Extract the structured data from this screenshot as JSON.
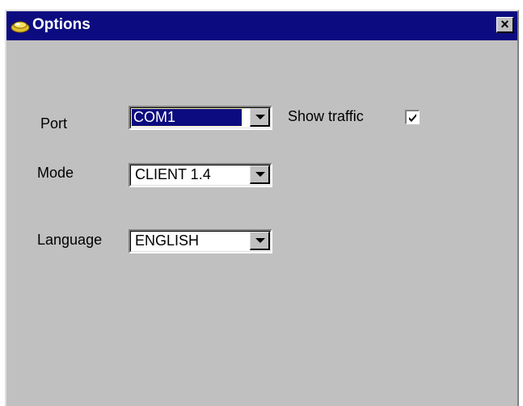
{
  "window": {
    "title": "Options",
    "title_icon": "app-icon",
    "close_glyph": "✕"
  },
  "form": {
    "port": {
      "label": "Port",
      "value": "COM1"
    },
    "mode": {
      "label": "Mode",
      "value": "CLIENT 1.4"
    },
    "language": {
      "label": "Language",
      "value": "ENGLISH"
    },
    "show_traffic": {
      "label": "Show traffic",
      "checked": true
    }
  },
  "colors": {
    "titlebar": "#0c0c80",
    "face": "#c0c0c0",
    "selection": "#0c0c80"
  }
}
